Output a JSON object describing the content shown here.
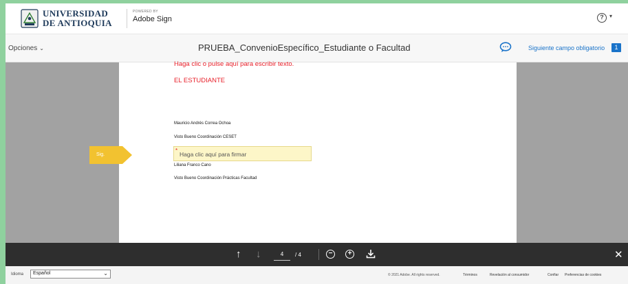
{
  "header": {
    "logo_line1": "UNIVERSIDAD",
    "logo_line2": "DE ANTIOQUIA",
    "powered_by": "POWERED BY",
    "product": "Adobe Sign",
    "help_glyph": "?",
    "help_caret": "▾"
  },
  "toolbar": {
    "options_label": "Opciones",
    "options_chevron": "⌄",
    "document_title": "PRUEBA_ConvenioEspecífico_Estudiante o Facultad",
    "next_field_label": "Siguiente campo obligatorio",
    "next_field_count": "1"
  },
  "document": {
    "red_placeholder": "Haga clic o pulse aquí para escribir texto.",
    "section_heading": "EL ESTUDIANTE",
    "lines": [
      "Mauricio Andrés Correa Ochoa",
      "Visto Bueno Coordinación CESET",
      "Liliana Franco Cano",
      "Visto Bueno Coordinación Prácticas Facultad"
    ],
    "signature_required_mark": "*",
    "signature_placeholder": "Haga clic aquí para firmar",
    "sig_tag": "Sig."
  },
  "navbar": {
    "up_glyph": "↑",
    "down_glyph": "↓",
    "current_page": "4",
    "total_pages": "/ 4",
    "zoom_out_glyph": "−",
    "zoom_in_glyph": "+",
    "close_glyph": "✕"
  },
  "footer": {
    "language_label": "Idioma",
    "language_value": "Español",
    "language_chevron": "⌄",
    "copyright": "© 2021 Adobe. All rights reserved.",
    "links": [
      "Términos",
      "Revelación al consumidor",
      "Confiar",
      "Preferencias de cookies"
    ]
  },
  "colors": {
    "outer_background": "#8fd19e",
    "accent_blue": "#1a73c9",
    "required_red": "#e8202a",
    "signature_field": "#fdf6c8",
    "sig_tag": "#f2c230",
    "navbar": "#2e2e2e",
    "viewer_gray": "#a2a2a2"
  },
  "icons": [
    "university-seal-icon",
    "help-icon",
    "comment-icon",
    "arrow-up-icon",
    "arrow-down-icon",
    "zoom-out-icon",
    "zoom-in-icon",
    "download-icon",
    "close-icon",
    "chevron-down-icon"
  ]
}
